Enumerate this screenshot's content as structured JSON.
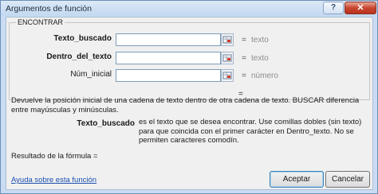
{
  "window": {
    "title": "Argumentos de función",
    "help_label": "?",
    "close_label": "✕"
  },
  "group": {
    "title": "ENCONTRAR",
    "args": [
      {
        "label": "Texto_buscado",
        "value": "",
        "equals": "=",
        "type_hint": "texto",
        "icon": "range-select-icon"
      },
      {
        "label": "Dentro_del_texto",
        "value": "",
        "equals": "=",
        "type_hint": "texto",
        "icon": "range-select-icon"
      },
      {
        "label": "Núm_inicial",
        "value": "",
        "equals": "=",
        "type_hint": "número",
        "icon": "range-select-icon"
      }
    ],
    "result_equals": "="
  },
  "description": "Devuelve la posición inicial de una cadena de texto dentro de otra cadena de texto. BUSCAR diferencia entre mayúsculas y minúsculas.",
  "param_help": {
    "name": "Texto_buscado",
    "text": "es el texto que se desea encontrar. Use comillas dobles (sin texto) para que coincida con  el primer carácter en Dentro_texto. No se permiten caracteres comodín."
  },
  "formula_result": "Resultado de la fórmula =",
  "help_link": "Ayuda sobre esta función",
  "buttons": {
    "ok": "Aceptar",
    "cancel": "Cancelar"
  },
  "colors": {
    "accent": "#3c7fb1",
    "link": "#1a4fb0",
    "close": "#c8452f"
  }
}
